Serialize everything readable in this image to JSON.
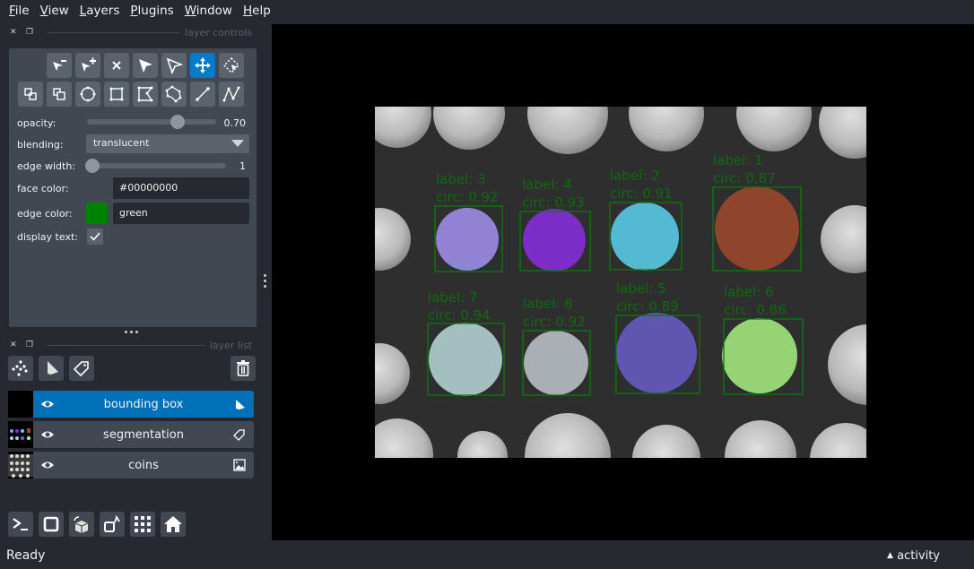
{
  "menubar": {
    "items": [
      {
        "mnemonic": "F",
        "rest": "ile"
      },
      {
        "mnemonic": "V",
        "rest": "iew"
      },
      {
        "mnemonic": "L",
        "rest": "ayers"
      },
      {
        "mnemonic": "P",
        "rest": "lugins"
      },
      {
        "mnemonic": "W",
        "rest": "indow"
      },
      {
        "mnemonic": "H",
        "rest": "elp"
      }
    ]
  },
  "layer_controls": {
    "header": "layer controls",
    "tools_row1": [
      "remove-vertex",
      "add-vertex",
      "delete-shape",
      "select-shape",
      "direct-select",
      "pan-zoom",
      "transform"
    ],
    "tools_row2": [
      "move-back",
      "move-front",
      "add-ellipse",
      "add-rectangle",
      "add-polygon",
      "add-polygon-lasso",
      "add-line",
      "add-path"
    ],
    "active_tool": "pan-zoom",
    "opacity": {
      "label": "opacity:",
      "value": 0.7,
      "display": "0.70"
    },
    "blending": {
      "label": "blending:",
      "value": "translucent"
    },
    "edge_width": {
      "label": "edge width:",
      "value": 1,
      "min": 0,
      "max": 40,
      "display": "1"
    },
    "face_color": {
      "label": "face color:",
      "value": "#00000000"
    },
    "edge_color": {
      "label": "edge color:",
      "value": "green",
      "swatch": "#008000"
    },
    "display_text": {
      "label": "display text:",
      "checked": true
    }
  },
  "layer_list": {
    "header": "layer list",
    "layers": [
      {
        "name": "bounding box",
        "type": "shapes",
        "selected": true,
        "visible": true
      },
      {
        "name": "segmentation",
        "type": "labels",
        "selected": false,
        "visible": true
      },
      {
        "name": "coins",
        "type": "image",
        "selected": false,
        "visible": true
      }
    ]
  },
  "bottom_toolbar": [
    "console",
    "ndisplay-toggle",
    "roll-dims",
    "transpose-dims",
    "grid-mode",
    "home"
  ],
  "status": {
    "text": "Ready",
    "activity": "activity"
  },
  "canvas": {
    "annotations": [
      {
        "label": "label: 3",
        "circ": "circ: 0.92",
        "color": "#a390f0"
      },
      {
        "label": "label: 4",
        "circ": "circ: 0.93",
        "color": "#8a2be2"
      },
      {
        "label": "label: 2",
        "circ": "circ: 0.91",
        "color": "#5ad2f0"
      },
      {
        "label": "label: 1",
        "circ": "circ: 0.87",
        "color": "#a0492a"
      },
      {
        "label": "label: 7",
        "circ": "circ: 0.94",
        "color": "#b8d8d8"
      },
      {
        "label": "label: 8",
        "circ": "circ: 0.92",
        "color": "#c0c4cc"
      },
      {
        "label": "label: 5",
        "circ": "circ: 0.89",
        "color": "#6a5cc8"
      },
      {
        "label": "label: 6",
        "circ": "circ: 0.86",
        "color": "#a8f080"
      }
    ],
    "edge_color": "#0a7a0a"
  }
}
